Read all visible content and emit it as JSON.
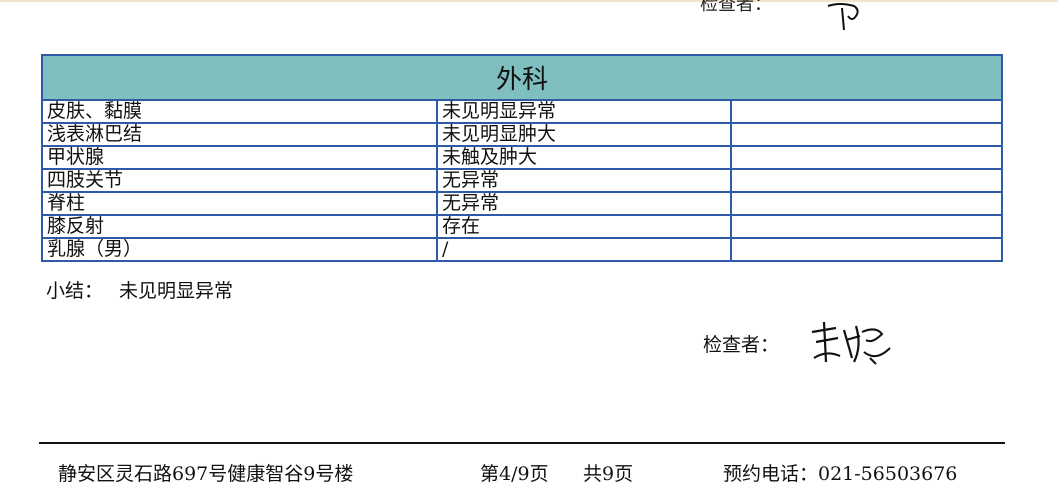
{
  "previous_page": {
    "inspector_label": "检查者："
  },
  "section": {
    "title": "外科",
    "rows": [
      {
        "item": "皮肤、黏膜",
        "result": "未见明显异常",
        "note": ""
      },
      {
        "item": "浅表淋巴结",
        "result": "未见明显肿大",
        "note": ""
      },
      {
        "item": "甲状腺",
        "result": "未触及肿大",
        "note": ""
      },
      {
        "item": "四肢关节",
        "result": "无异常",
        "note": ""
      },
      {
        "item": "脊柱",
        "result": "无异常",
        "note": ""
      },
      {
        "item": "膝反射",
        "result": "存在",
        "note": ""
      },
      {
        "item": "乳腺（男）",
        "result": "/",
        "note": ""
      }
    ]
  },
  "summary": {
    "label": "小结：",
    "value": "未见明显异常"
  },
  "inspector": {
    "label": "检查者："
  },
  "footer": {
    "address": "静安区灵石路697号健康智谷9号楼",
    "page": "第4/9页",
    "total": "共9页",
    "phone": "预约电话：021-56503676"
  },
  "colors": {
    "header_bg": "#7fbfbf",
    "grid_line": "#2e5aa8"
  }
}
